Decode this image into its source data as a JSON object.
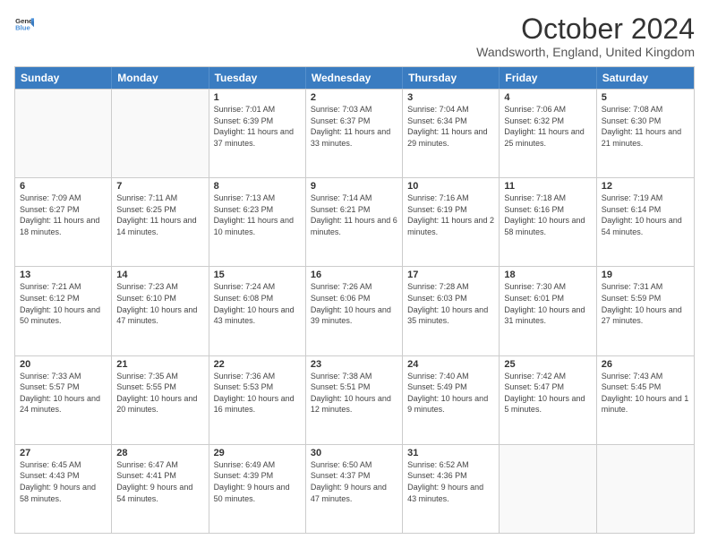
{
  "logo": {
    "line1": "General",
    "line2": "Blue"
  },
  "title": "October 2024",
  "subtitle": "Wandsworth, England, United Kingdom",
  "days_of_week": [
    "Sunday",
    "Monday",
    "Tuesday",
    "Wednesday",
    "Thursday",
    "Friday",
    "Saturday"
  ],
  "weeks": [
    [
      {
        "day": "",
        "info": ""
      },
      {
        "day": "",
        "info": ""
      },
      {
        "day": "1",
        "info": "Sunrise: 7:01 AM\nSunset: 6:39 PM\nDaylight: 11 hours and 37 minutes."
      },
      {
        "day": "2",
        "info": "Sunrise: 7:03 AM\nSunset: 6:37 PM\nDaylight: 11 hours and 33 minutes."
      },
      {
        "day": "3",
        "info": "Sunrise: 7:04 AM\nSunset: 6:34 PM\nDaylight: 11 hours and 29 minutes."
      },
      {
        "day": "4",
        "info": "Sunrise: 7:06 AM\nSunset: 6:32 PM\nDaylight: 11 hours and 25 minutes."
      },
      {
        "day": "5",
        "info": "Sunrise: 7:08 AM\nSunset: 6:30 PM\nDaylight: 11 hours and 21 minutes."
      }
    ],
    [
      {
        "day": "6",
        "info": "Sunrise: 7:09 AM\nSunset: 6:27 PM\nDaylight: 11 hours and 18 minutes."
      },
      {
        "day": "7",
        "info": "Sunrise: 7:11 AM\nSunset: 6:25 PM\nDaylight: 11 hours and 14 minutes."
      },
      {
        "day": "8",
        "info": "Sunrise: 7:13 AM\nSunset: 6:23 PM\nDaylight: 11 hours and 10 minutes."
      },
      {
        "day": "9",
        "info": "Sunrise: 7:14 AM\nSunset: 6:21 PM\nDaylight: 11 hours and 6 minutes."
      },
      {
        "day": "10",
        "info": "Sunrise: 7:16 AM\nSunset: 6:19 PM\nDaylight: 11 hours and 2 minutes."
      },
      {
        "day": "11",
        "info": "Sunrise: 7:18 AM\nSunset: 6:16 PM\nDaylight: 10 hours and 58 minutes."
      },
      {
        "day": "12",
        "info": "Sunrise: 7:19 AM\nSunset: 6:14 PM\nDaylight: 10 hours and 54 minutes."
      }
    ],
    [
      {
        "day": "13",
        "info": "Sunrise: 7:21 AM\nSunset: 6:12 PM\nDaylight: 10 hours and 50 minutes."
      },
      {
        "day": "14",
        "info": "Sunrise: 7:23 AM\nSunset: 6:10 PM\nDaylight: 10 hours and 47 minutes."
      },
      {
        "day": "15",
        "info": "Sunrise: 7:24 AM\nSunset: 6:08 PM\nDaylight: 10 hours and 43 minutes."
      },
      {
        "day": "16",
        "info": "Sunrise: 7:26 AM\nSunset: 6:06 PM\nDaylight: 10 hours and 39 minutes."
      },
      {
        "day": "17",
        "info": "Sunrise: 7:28 AM\nSunset: 6:03 PM\nDaylight: 10 hours and 35 minutes."
      },
      {
        "day": "18",
        "info": "Sunrise: 7:30 AM\nSunset: 6:01 PM\nDaylight: 10 hours and 31 minutes."
      },
      {
        "day": "19",
        "info": "Sunrise: 7:31 AM\nSunset: 5:59 PM\nDaylight: 10 hours and 27 minutes."
      }
    ],
    [
      {
        "day": "20",
        "info": "Sunrise: 7:33 AM\nSunset: 5:57 PM\nDaylight: 10 hours and 24 minutes."
      },
      {
        "day": "21",
        "info": "Sunrise: 7:35 AM\nSunset: 5:55 PM\nDaylight: 10 hours and 20 minutes."
      },
      {
        "day": "22",
        "info": "Sunrise: 7:36 AM\nSunset: 5:53 PM\nDaylight: 10 hours and 16 minutes."
      },
      {
        "day": "23",
        "info": "Sunrise: 7:38 AM\nSunset: 5:51 PM\nDaylight: 10 hours and 12 minutes."
      },
      {
        "day": "24",
        "info": "Sunrise: 7:40 AM\nSunset: 5:49 PM\nDaylight: 10 hours and 9 minutes."
      },
      {
        "day": "25",
        "info": "Sunrise: 7:42 AM\nSunset: 5:47 PM\nDaylight: 10 hours and 5 minutes."
      },
      {
        "day": "26",
        "info": "Sunrise: 7:43 AM\nSunset: 5:45 PM\nDaylight: 10 hours and 1 minute."
      }
    ],
    [
      {
        "day": "27",
        "info": "Sunrise: 6:45 AM\nSunset: 4:43 PM\nDaylight: 9 hours and 58 minutes."
      },
      {
        "day": "28",
        "info": "Sunrise: 6:47 AM\nSunset: 4:41 PM\nDaylight: 9 hours and 54 minutes."
      },
      {
        "day": "29",
        "info": "Sunrise: 6:49 AM\nSunset: 4:39 PM\nDaylight: 9 hours and 50 minutes."
      },
      {
        "day": "30",
        "info": "Sunrise: 6:50 AM\nSunset: 4:37 PM\nDaylight: 9 hours and 47 minutes."
      },
      {
        "day": "31",
        "info": "Sunrise: 6:52 AM\nSunset: 4:36 PM\nDaylight: 9 hours and 43 minutes."
      },
      {
        "day": "",
        "info": ""
      },
      {
        "day": "",
        "info": ""
      }
    ]
  ]
}
